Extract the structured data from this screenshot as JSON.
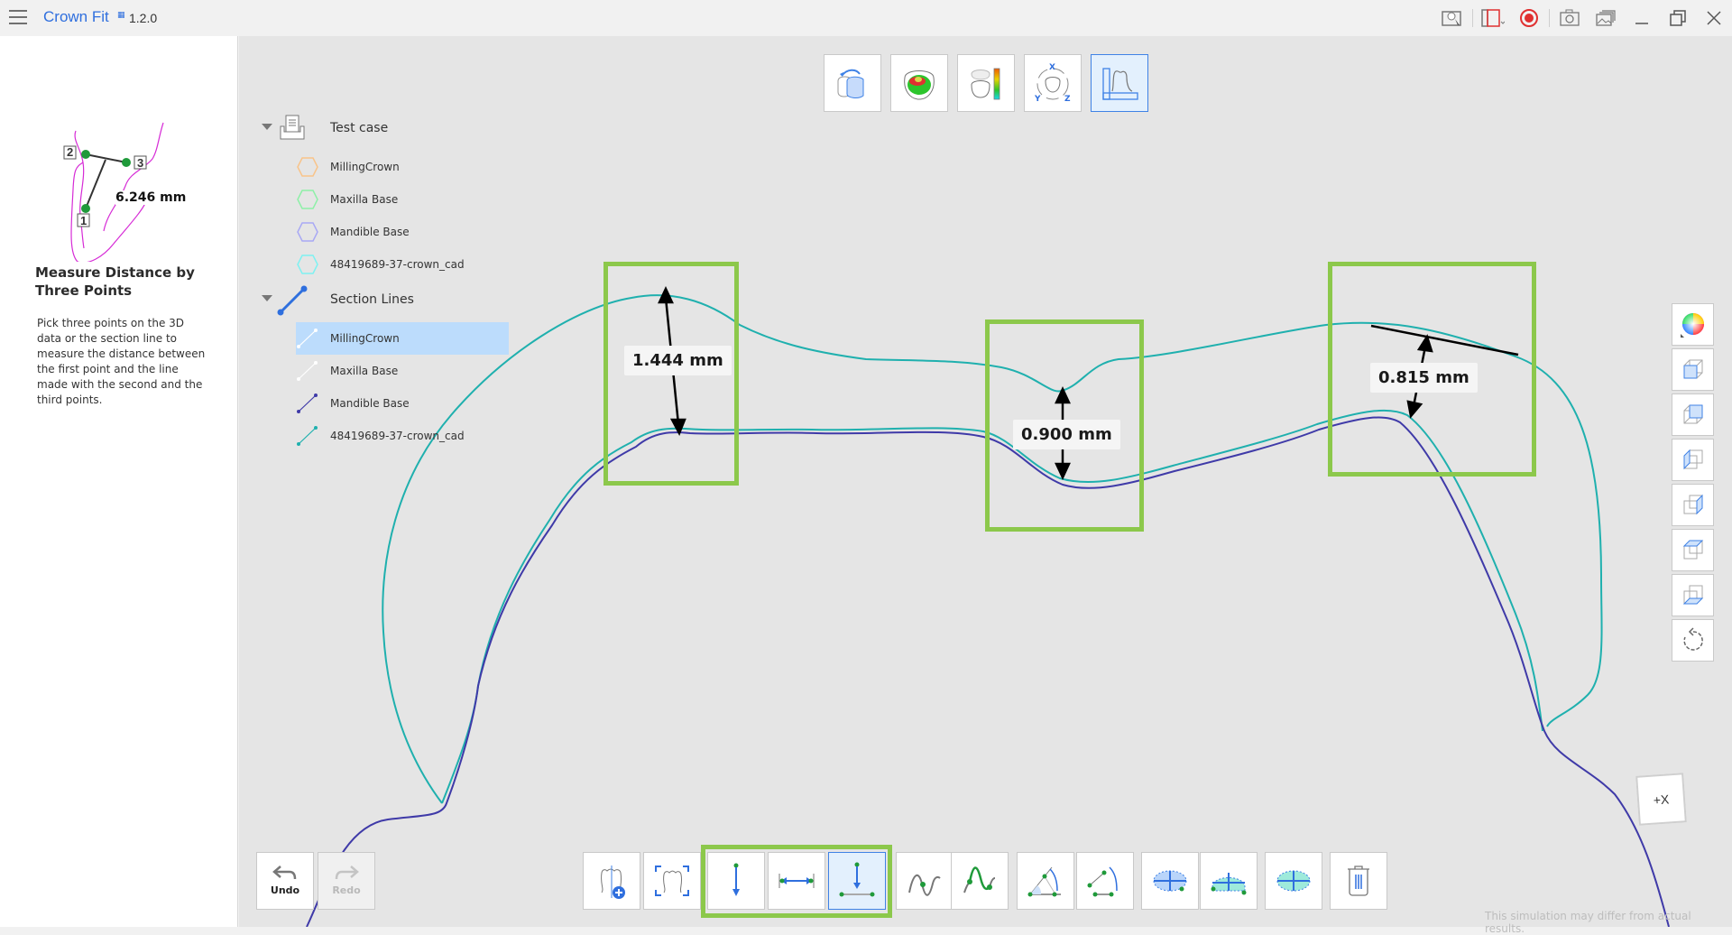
{
  "app": {
    "title": "Crown Fit",
    "version": "1.2.0",
    "window_controls": [
      "tips-icon",
      "screen-capture-area-icon",
      "record-icon",
      "camera-icon",
      "gallery-icon",
      "minimize-icon",
      "restore-icon",
      "close-icon"
    ]
  },
  "left_panel": {
    "preview": {
      "measurement": "6.246 mm",
      "point_labels": [
        "1",
        "2",
        "3"
      ]
    },
    "tool_title": "Measure Distance by Three Points",
    "tool_description": "Pick three points on the 3D data or the section line to measure the distance between the first point and the line made with the second and the third points."
  },
  "tree": {
    "groups": [
      {
        "label": "Test case",
        "items": [
          {
            "label": "MillingCrown",
            "color": "#f9c48a"
          },
          {
            "label": "Maxilla Base",
            "color": "#8ef0a8"
          },
          {
            "label": "Mandible Base",
            "color": "#a9a9f5"
          },
          {
            "label": "48419689-37-crown_cad",
            "color": "#7ef2f2"
          }
        ]
      },
      {
        "label": "Section Lines",
        "items": [
          {
            "label": "MillingCrown",
            "color": "#ffffff",
            "selected": true
          },
          {
            "label": "Maxilla Base",
            "color": "#ffffff"
          },
          {
            "label": "Mandible Base",
            "color": "#3f3aa8"
          },
          {
            "label": "48419689-37-crown_cad",
            "color": "#1fb0ae"
          }
        ]
      }
    ]
  },
  "top_toolbar": {
    "buttons": [
      {
        "name": "align-icon",
        "active": false
      },
      {
        "name": "occlusion-map-icon",
        "active": false
      },
      {
        "name": "color-map-icon",
        "active": false
      },
      {
        "name": "xyz-rotate-icon",
        "active": false
      },
      {
        "name": "section-measure-icon",
        "active": true
      }
    ]
  },
  "right_toolbar": {
    "buttons": [
      "color-wheel-icon",
      "view-front-icon",
      "view-back-icon",
      "view-left-icon",
      "view-right-icon",
      "view-top-icon",
      "view-bottom-icon",
      "reset-view-icon"
    ]
  },
  "bottom_toolbar": {
    "undo_label": "Undo",
    "redo_label": "Redo",
    "tools": [
      "add-section-icon",
      "fit-section-icon",
      "point-distance-icon",
      "horizontal-distance-icon",
      "three-point-distance-icon",
      "curve-point-icon",
      "curve-length-icon",
      "angle-icon",
      "three-point-angle-icon",
      "area-icon",
      "section-area-icon",
      "ellipse-area-icon",
      "delete-icon"
    ],
    "active_tool": "three-point-distance-icon"
  },
  "measurements": [
    {
      "value": "1.444 mm"
    },
    {
      "value": "0.900 mm"
    },
    {
      "value": "0.815 mm"
    }
  ],
  "colors": {
    "accent": "#2f6fde",
    "highlight": "#8cc84b",
    "crown_line": "#1fb0ae",
    "mandible_line": "#3f3aa8",
    "preview_line": "#d62bd6"
  },
  "axis_widget": "+X",
  "disclaimer": "This simulation may differ from actual results."
}
